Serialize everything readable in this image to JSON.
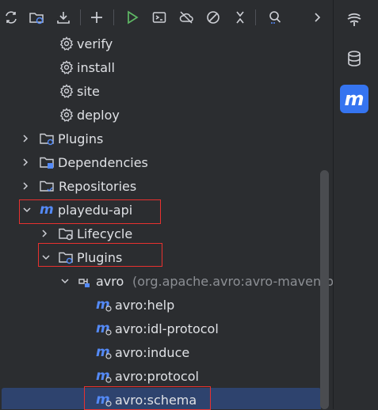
{
  "toolbar": {
    "icons": [
      "reload-icon",
      "reimport-icon",
      "download-icon",
      "add-icon",
      "run-icon",
      "execute-goal-icon",
      "toggle-offline-icon",
      "skip-tests-icon",
      "collapse-icon",
      "analyze-icon",
      "more-icon"
    ]
  },
  "tree": {
    "lifecycle_items": [
      {
        "label": "verify"
      },
      {
        "label": "install"
      },
      {
        "label": "site"
      },
      {
        "label": "deploy"
      }
    ],
    "plugins_label": "Plugins",
    "dependencies_label": "Dependencies",
    "repositories_label": "Repositories",
    "project_label": "playedu-api",
    "project_lifecycle_label": "Lifecycle",
    "project_plugins_label": "Plugins",
    "plugin_name": "avro",
    "plugin_coords": "(org.apache.avro:avro-maven-plug",
    "goals": [
      {
        "label": "avro:help"
      },
      {
        "label": "avro:idl-protocol"
      },
      {
        "label": "avro:induce"
      },
      {
        "label": "avro:protocol"
      },
      {
        "label": "avro:schema"
      }
    ]
  },
  "rightbar": {
    "items": [
      "ai-assistant-icon",
      "database-icon",
      "maven-icon"
    ],
    "active": "maven-icon",
    "maven_glyph": "m"
  },
  "colors": {
    "background": "#2b2d30",
    "text": "#dfe1e5",
    "selection": "#2e436e",
    "highlight_box": "#e8312f",
    "maven_blue": "#548af7",
    "run_green": "#5fb865",
    "accent": "#3574f0"
  }
}
